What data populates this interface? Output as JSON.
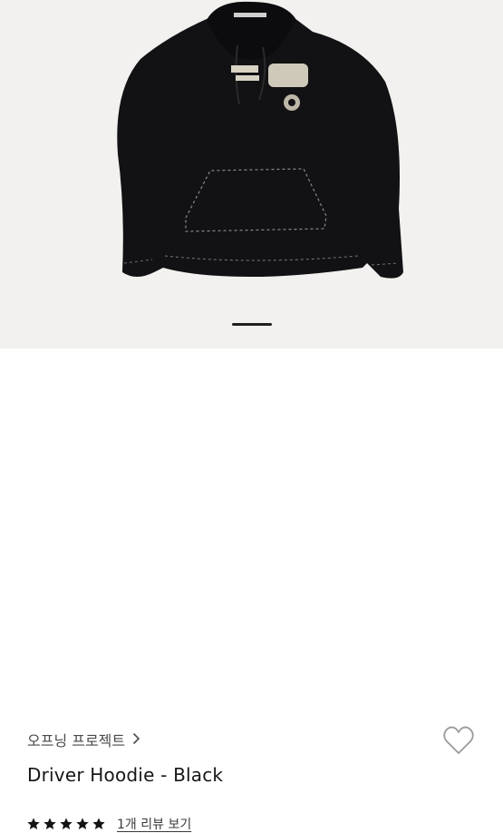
{
  "product": {
    "brand": "오프닝 프로젝트",
    "title": "Driver Hoodie - Black",
    "rating_stars": 5,
    "review_link": "1개 리뷰 보기",
    "image_pages_active": 1
  },
  "icons": {
    "brand_chevron": "chevron-right-icon",
    "wishlist": "heart-outline-icon",
    "star": "star-icon"
  },
  "colors": {
    "image_bg": "#f2f1ef",
    "hoodie": "#121214",
    "stars": "#141414"
  }
}
